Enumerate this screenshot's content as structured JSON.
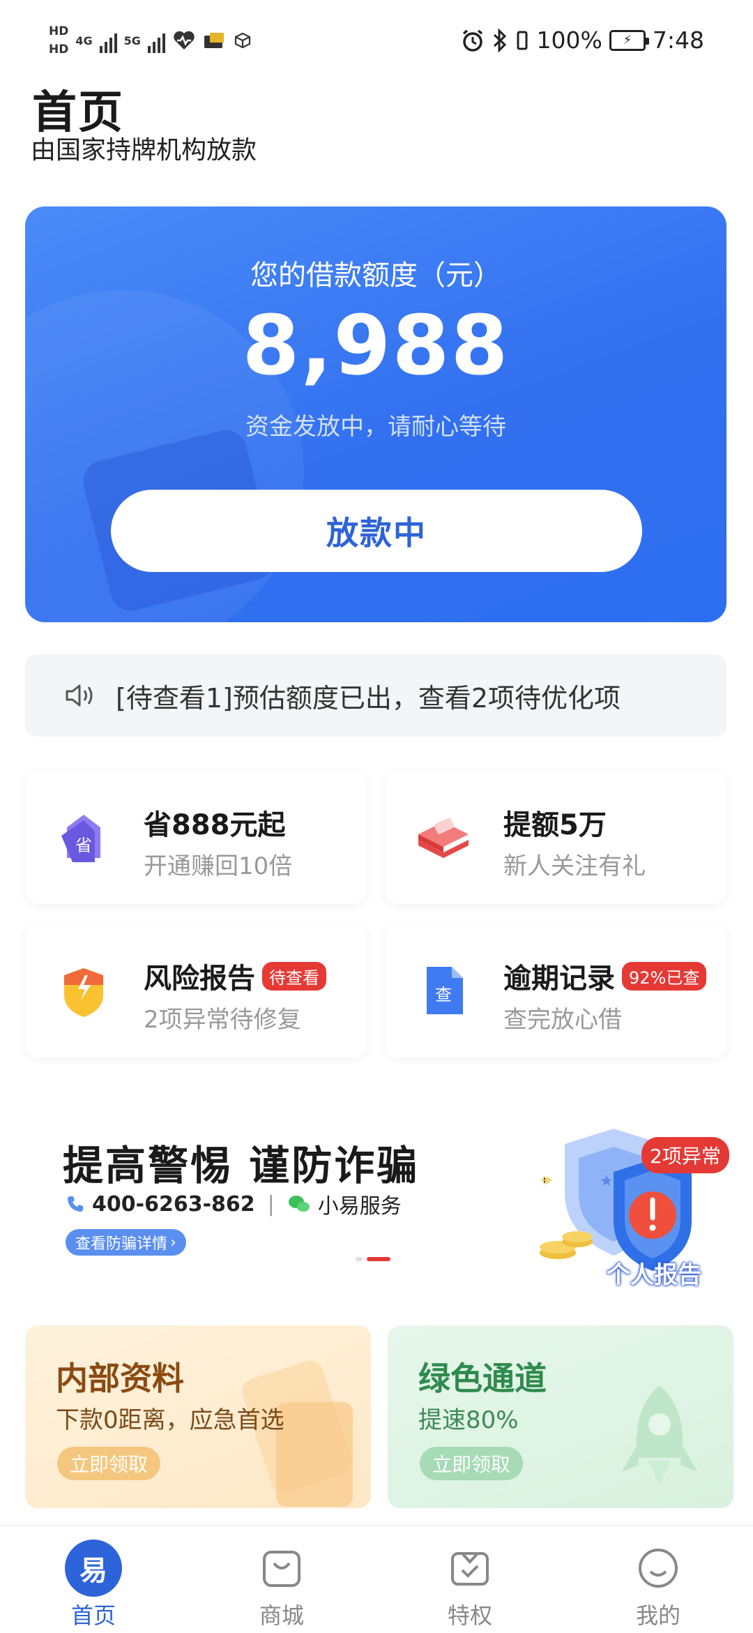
{
  "status_bar": {
    "hd1": "HD",
    "hd2": "HD",
    "net1": "4G",
    "net2": "5G",
    "battery": "100%",
    "time": "7:48"
  },
  "header": {
    "title": "首页",
    "subtitle": "由国家持牌机构放款"
  },
  "loan_card": {
    "label": "您的借款额度（元）",
    "amount": "8,988",
    "note": "资金发放中，请耐心等待",
    "button": "放款中"
  },
  "notice": {
    "text": "[待查看1]预估额度已出，查看2项待优化项",
    "icon": "speaker-icon"
  },
  "tiles": [
    {
      "title": "省888元起",
      "subtitle": "开通赚回10倍",
      "icon": "save-tag-icon",
      "icon_text": "省"
    },
    {
      "title": "提额5万",
      "subtitle": "新人关注有礼",
      "icon": "money-stack-icon"
    },
    {
      "title": "风险报告",
      "badge": "待查看",
      "subtitle": "2项异常待修复",
      "icon": "risk-shield-icon"
    },
    {
      "title": "逾期记录",
      "badge": "92%已查",
      "subtitle": "查完放心借",
      "icon": "document-check-icon",
      "icon_text": "查"
    }
  ],
  "banner": {
    "title": "提高警惕 谨防诈骗",
    "phone": "400-6263-862",
    "separator": "|",
    "service": "小易服务",
    "link": "查看防骗详情",
    "abnormal_badge": "2项异常",
    "report_label": "个人报告"
  },
  "promos": [
    {
      "title": "内部资料",
      "subtitle": "下款0距离，应急首选",
      "button": "立即领取",
      "color_title": "#8a4a12",
      "color_sub": "#7a4a18",
      "color_btn": "#f5c77e"
    },
    {
      "title": "绿色通道",
      "subtitle": "提速80%",
      "button": "立即领取",
      "color_title": "#2f8a4e",
      "color_sub": "#3d8a57",
      "color_btn": "#a6dbb5"
    }
  ],
  "tabbar": [
    {
      "label": "首页",
      "icon": "home-icon",
      "active": true,
      "icon_text": "易"
    },
    {
      "label": "商城",
      "icon": "shopping-bag-icon",
      "active": false
    },
    {
      "label": "特权",
      "icon": "privilege-icon",
      "active": false
    },
    {
      "label": "我的",
      "icon": "profile-icon",
      "active": false
    }
  ],
  "colors": {
    "primary": "#3270f0",
    "badge_red": "#e53935",
    "tab_active": "#2d63d8"
  }
}
